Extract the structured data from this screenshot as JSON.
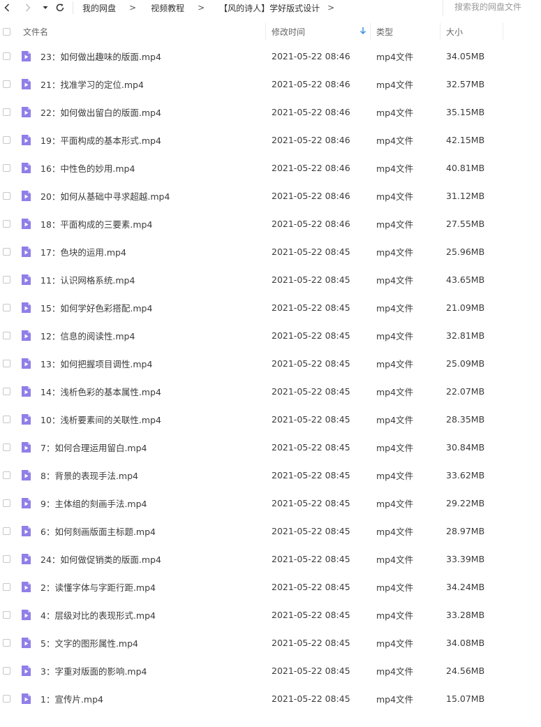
{
  "nav": {
    "back_icon": "chevron-left-icon",
    "forward_icon": "chevron-right-icon",
    "history_icon": "caret-down-icon",
    "refresh_icon": "refresh-icon"
  },
  "breadcrumb": [
    {
      "label": "我的网盘"
    },
    {
      "label": "视频教程"
    },
    {
      "label": "【风的诗人】学好版式设计"
    }
  ],
  "breadcrumb_separator": ">",
  "search": {
    "placeholder": "搜索我的网盘文件"
  },
  "columns": {
    "name": "文件名",
    "modified": "修改时间",
    "type": "类型",
    "size": "大小",
    "sort_icon": "arrow-down-icon"
  },
  "colors": {
    "file_icon": "#8f7fe8",
    "sort_arrow": "#3a8ee6"
  },
  "files": [
    {
      "name": "23：如何做出趣味的版面.mp4",
      "modified": "2021-05-22 08:46",
      "type": "mp4文件",
      "size": "34.05MB"
    },
    {
      "name": "21：找准学习的定位.mp4",
      "modified": "2021-05-22 08:46",
      "type": "mp4文件",
      "size": "32.57MB"
    },
    {
      "name": "22：如何做出留白的版面.mp4",
      "modified": "2021-05-22 08:46",
      "type": "mp4文件",
      "size": "35.15MB"
    },
    {
      "name": "19：平面构成的基本形式.mp4",
      "modified": "2021-05-22 08:46",
      "type": "mp4文件",
      "size": "42.15MB"
    },
    {
      "name": "16：中性色的妙用.mp4",
      "modified": "2021-05-22 08:46",
      "type": "mp4文件",
      "size": "40.81MB"
    },
    {
      "name": "20：如何从基础中寻求超越.mp4",
      "modified": "2021-05-22 08:46",
      "type": "mp4文件",
      "size": "31.12MB"
    },
    {
      "name": "18：平面构成的三要素.mp4",
      "modified": "2021-05-22 08:46",
      "type": "mp4文件",
      "size": "27.55MB"
    },
    {
      "name": "17：色块的运用.mp4",
      "modified": "2021-05-22 08:45",
      "type": "mp4文件",
      "size": "25.96MB"
    },
    {
      "name": "11：认识网格系统.mp4",
      "modified": "2021-05-22 08:45",
      "type": "mp4文件",
      "size": "43.65MB"
    },
    {
      "name": "15：如何学好色彩搭配.mp4",
      "modified": "2021-05-22 08:45",
      "type": "mp4文件",
      "size": "21.09MB"
    },
    {
      "name": "12：信息的阅读性.mp4",
      "modified": "2021-05-22 08:45",
      "type": "mp4文件",
      "size": "32.81MB"
    },
    {
      "name": "13：如何把握项目调性.mp4",
      "modified": "2021-05-22 08:45",
      "type": "mp4文件",
      "size": "25.09MB"
    },
    {
      "name": "14：浅析色彩的基本属性.mp4",
      "modified": "2021-05-22 08:45",
      "type": "mp4文件",
      "size": "22.07MB"
    },
    {
      "name": "10：浅析要素间的关联性.mp4",
      "modified": "2021-05-22 08:45",
      "type": "mp4文件",
      "size": "28.35MB"
    },
    {
      "name": "7：如何合理运用留白.mp4",
      "modified": "2021-05-22 08:45",
      "type": "mp4文件",
      "size": "30.84MB"
    },
    {
      "name": "8：背景的表现手法.mp4",
      "modified": "2021-05-22 08:45",
      "type": "mp4文件",
      "size": "33.62MB"
    },
    {
      "name": "9：主体组的刻画手法.mp4",
      "modified": "2021-05-22 08:45",
      "type": "mp4文件",
      "size": "29.22MB"
    },
    {
      "name": "6：如何刻画版面主标题.mp4",
      "modified": "2021-05-22 08:45",
      "type": "mp4文件",
      "size": "28.97MB"
    },
    {
      "name": "24：如何做促销类的版面.mp4",
      "modified": "2021-05-22 08:45",
      "type": "mp4文件",
      "size": "33.39MB"
    },
    {
      "name": "2：读懂字体与字距行距.mp4",
      "modified": "2021-05-22 08:45",
      "type": "mp4文件",
      "size": "34.24MB"
    },
    {
      "name": "4：层级对比的表现形式.mp4",
      "modified": "2021-05-22 08:45",
      "type": "mp4文件",
      "size": "33.28MB"
    },
    {
      "name": "5：文字的图形属性.mp4",
      "modified": "2021-05-22 08:45",
      "type": "mp4文件",
      "size": "34.08MB"
    },
    {
      "name": "3：字重对版面的影响.mp4",
      "modified": "2021-05-22 08:45",
      "type": "mp4文件",
      "size": "24.56MB"
    },
    {
      "name": "1：宣传片.mp4",
      "modified": "2021-05-22 08:45",
      "type": "mp4文件",
      "size": "15.07MB"
    }
  ]
}
